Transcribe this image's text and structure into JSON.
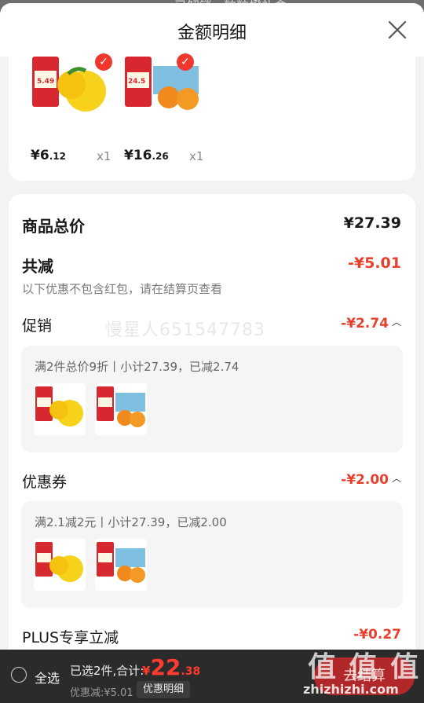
{
  "background": {
    "top_text": "已解锁 · 粒粒橙礼盒"
  },
  "header": {
    "title": "金额明细",
    "close_icon": "close-icon"
  },
  "items": [
    {
      "price_int": "6",
      "price_dec": ".12",
      "currency": "¥",
      "qty": "x1",
      "image": "lemon-product"
    },
    {
      "price_int": "16",
      "price_dec": ".26",
      "currency": "¥",
      "qty": "x1",
      "image": "orange-gift-box"
    }
  ],
  "summary": {
    "goods_total_label": "商品总价",
    "goods_total_value": "¥27.39",
    "total_reduce_label": "共减",
    "total_reduce_value": "-¥5.01",
    "note": "以下优惠不包含红包，请在结算页查看",
    "promo": {
      "label": "促销",
      "value": "-¥2.74",
      "detail": "满2件总价9折丨小计27.39，已减2.74"
    },
    "coupon": {
      "label": "优惠券",
      "value": "-¥2.00",
      "detail": "满2.1减2元丨小计27.39，已减2.00"
    },
    "plus": {
      "label": "PLUS专享立减",
      "value": "-¥0.27"
    }
  },
  "watermark": "慢星人651547783",
  "bottom_bar": {
    "select_all": "全选",
    "selected_text": "已选2件,合计:",
    "total_symbol": "¥",
    "total_int": "22",
    "total_dec": ".38",
    "discount_text": "优惠减:¥5.01",
    "detail_button": "优惠明细",
    "checkout_button": "去结算"
  },
  "site_watermark": {
    "mark": "值 值 值",
    "url": "zhizhizhi.com"
  }
}
